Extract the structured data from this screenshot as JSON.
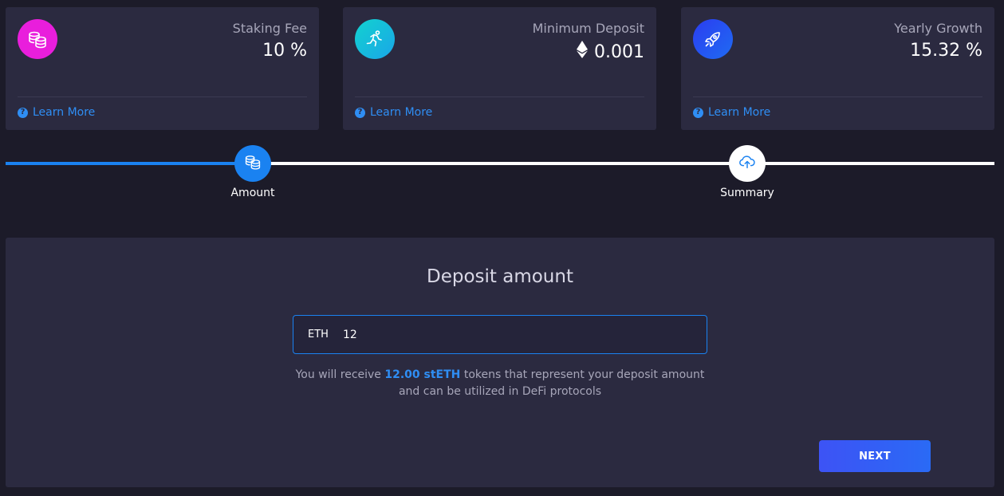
{
  "cards": [
    {
      "label": "Staking Fee",
      "value": "10 %",
      "icon": "coins-icon",
      "icon_color": "#e91edc",
      "learn_more": "Learn More"
    },
    {
      "label": "Minimum Deposit",
      "value": "0.001",
      "value_icon": "ethereum-icon",
      "icon": "runner-icon",
      "icon_color": "#17c6d9",
      "learn_more": "Learn More"
    },
    {
      "label": "Yearly Growth",
      "value": "15.32 %",
      "icon": "rocket-icon",
      "icon_color": "#2a4ff2",
      "learn_more": "Learn More"
    }
  ],
  "stepper": {
    "progress": 0.25,
    "steps": [
      {
        "label": "Amount",
        "icon": "coins-icon",
        "active": true
      },
      {
        "label": "Summary",
        "icon": "cloud-upload-icon",
        "active": false
      }
    ]
  },
  "deposit": {
    "title": "Deposit amount",
    "currency": "ETH",
    "amount": "12",
    "info_before": "You will receive ",
    "info_highlight": "12.00 stETH",
    "info_after": " tokens that represent your deposit amount",
    "info_line2": "and can be utilized in DeFi protocols",
    "next_label": "NEXT"
  },
  "colors": {
    "accent": "#1a82f1",
    "background": "#1c1b29",
    "card": "#2b2a40"
  }
}
